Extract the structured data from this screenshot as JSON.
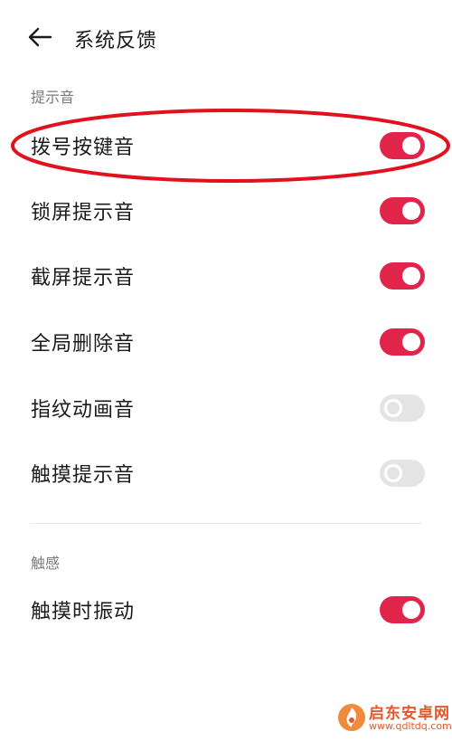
{
  "header": {
    "title": "系统反馈",
    "back_icon": "arrow-left-icon"
  },
  "sections": {
    "sounds_label": "提示音",
    "haptics_label": "触感"
  },
  "settings": [
    {
      "label": "拨号按键音",
      "enabled": true
    },
    {
      "label": "锁屏提示音",
      "enabled": true
    },
    {
      "label": "截屏提示音",
      "enabled": true
    },
    {
      "label": "全局删除音",
      "enabled": true
    },
    {
      "label": "指纹动画音",
      "enabled": false
    },
    {
      "label": "触摸提示音",
      "enabled": false
    },
    {
      "label": "触摸时振动",
      "enabled": true
    }
  ],
  "colors": {
    "toggle_on": "#e0244a",
    "toggle_off": "#e4e4e4",
    "annotation": "#e3101e",
    "watermark": "#e4572e"
  },
  "watermark": {
    "name": "启东安卓网",
    "url": "www.qdltdq.com"
  }
}
